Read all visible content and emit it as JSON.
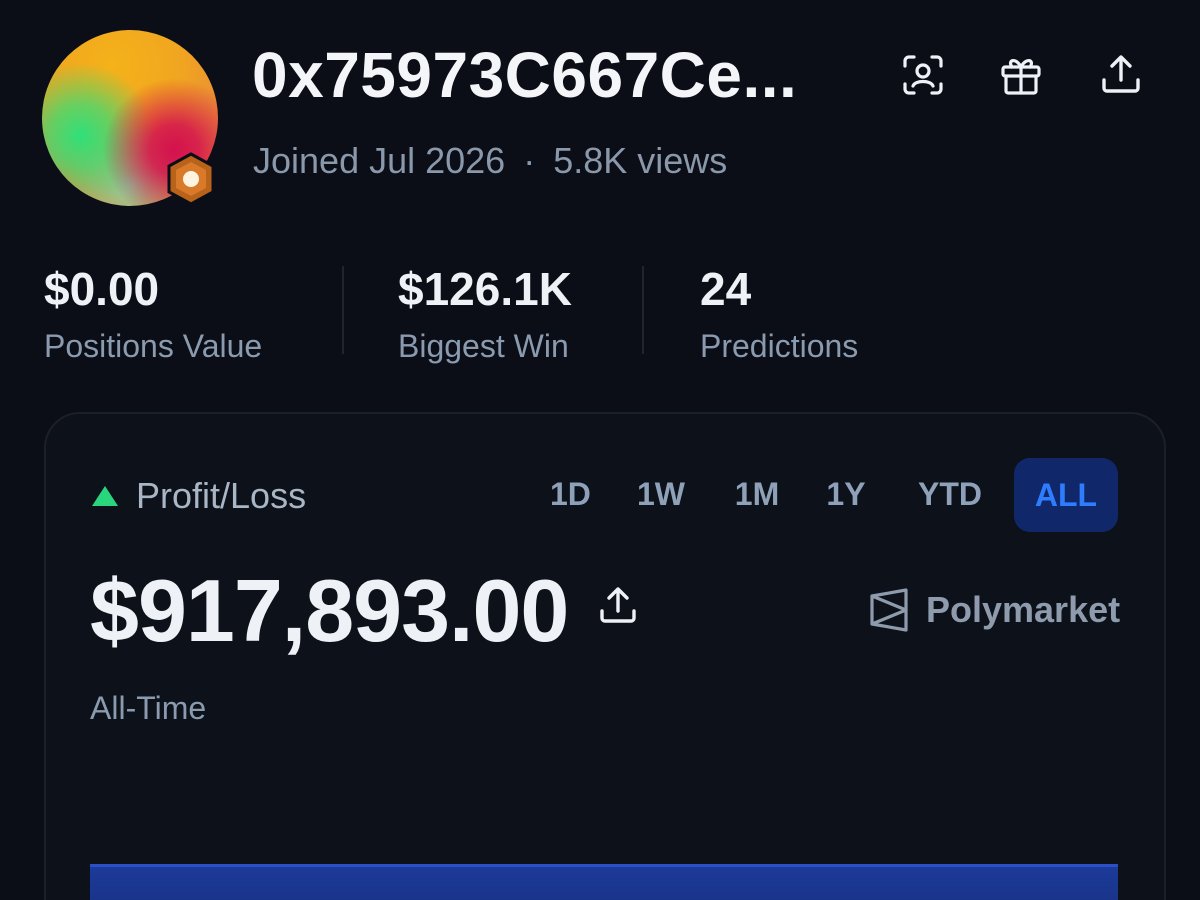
{
  "profile": {
    "username": "0x75973C667Ce...",
    "joined": "Joined Jul 2026",
    "separator": "·",
    "views": "5.8K views"
  },
  "header_icons": [
    "scan-face-icon",
    "gift-icon",
    "share-icon"
  ],
  "stats": [
    {
      "value": "$0.00",
      "label": "Positions Value"
    },
    {
      "value": "$126.1K",
      "label": "Biggest Win"
    },
    {
      "value": "24",
      "label": "Predictions"
    }
  ],
  "pnl": {
    "label": "Profit/Loss",
    "amount": "$917,893.00",
    "period_label": "All-Time",
    "brand": "Polymarket",
    "ranges": [
      "1D",
      "1W",
      "1M",
      "1Y",
      "YTD",
      "ALL"
    ],
    "selected_range": "ALL"
  },
  "colors": {
    "background": "#0b0e16",
    "accent_blue": "#2f7dff",
    "positive_green": "#2ad67d",
    "selected_pill": "#10276a"
  }
}
